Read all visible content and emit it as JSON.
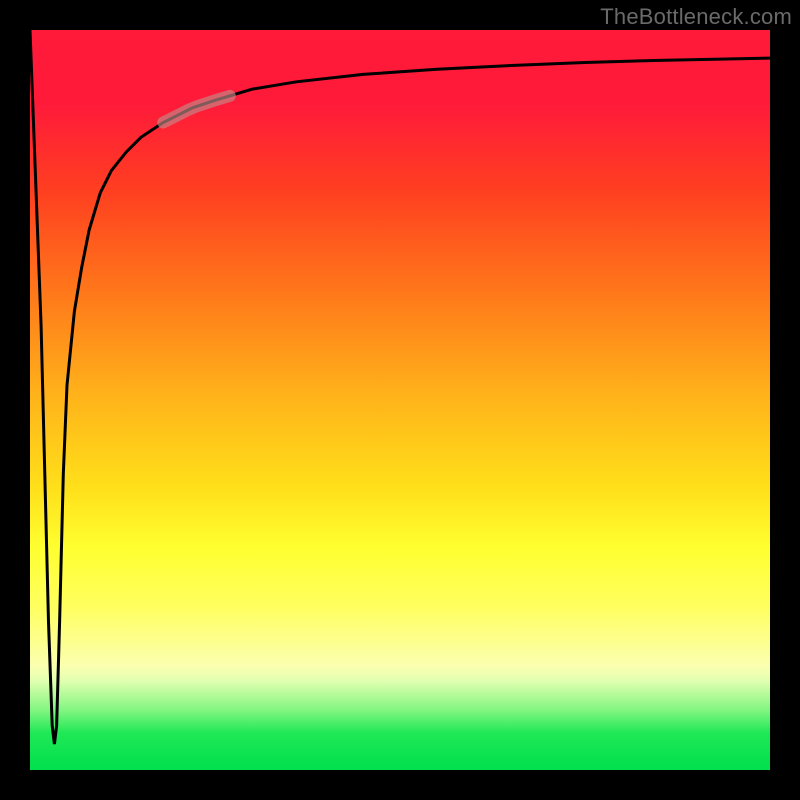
{
  "source_label": "TheBottleneck.com",
  "colors": {
    "page_bg": "#000000",
    "gradient_top": "#ff1a3a",
    "gradient_mid": "#ffff30",
    "gradient_bottom": "#00df4d",
    "curve": "#000000",
    "highlight_segment": "#c28a88",
    "label": "#6a6a6a"
  },
  "chart_data": {
    "type": "line",
    "title": "",
    "subtitle": "",
    "xlabel": "",
    "ylabel": "",
    "xlim": [
      0,
      100
    ],
    "ylim": [
      0,
      100
    ],
    "grid": false,
    "legend": false,
    "series": [
      {
        "name": "bottleneck-curve",
        "x": [
          0,
          1.5,
          2.5,
          3.0,
          3.3,
          3.6,
          4.0,
          4.5,
          5.0,
          6.0,
          7.0,
          8.0,
          9.5,
          11.0,
          13.0,
          15.0,
          18.0,
          22.0,
          25.0,
          30.0,
          36.0,
          45.0,
          55.0,
          65.0,
          75.0,
          85.0,
          95.0,
          100.0
        ],
        "y": [
          100,
          60,
          20,
          6,
          3.5,
          6,
          20,
          40,
          52,
          62,
          68,
          73,
          78,
          81,
          83.5,
          85.5,
          87.5,
          89.5,
          90.5,
          92,
          93,
          94,
          94.7,
          95.2,
          95.6,
          95.9,
          96.1,
          96.2
        ]
      }
    ],
    "annotations": [
      {
        "name": "highlighted-segment",
        "x_range": [
          18,
          27
        ],
        "y_range": [
          87.5,
          91
        ],
        "color": "#c28a88"
      }
    ]
  }
}
